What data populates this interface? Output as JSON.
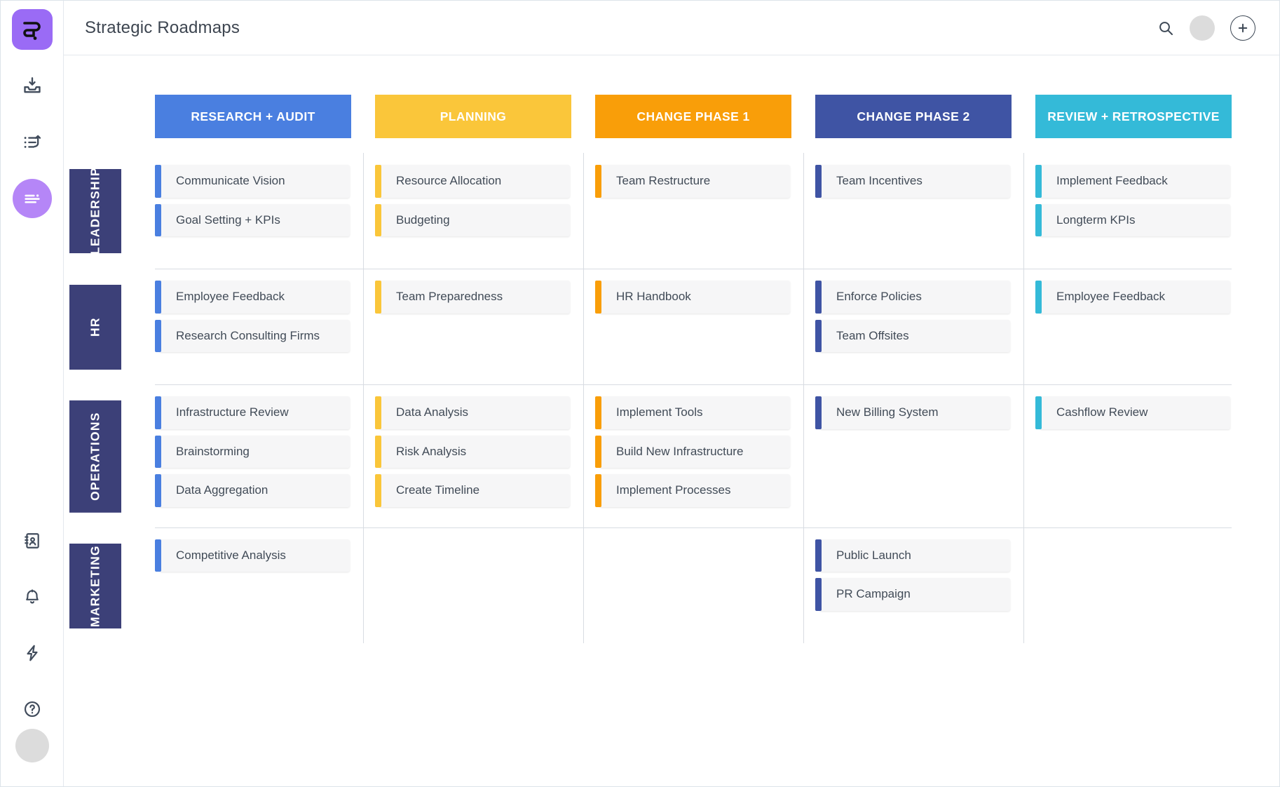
{
  "app": {
    "title": "Strategic Roadmaps",
    "logo_icon": "squiggle-logo-icon",
    "accent": "#9a6bf5"
  },
  "topbar": {
    "search_icon": "search-icon",
    "avatar": "user-avatar",
    "add_label": "+",
    "add_icon": "plus-icon"
  },
  "sidebar": {
    "items": [
      {
        "icon": "inbox-download-icon",
        "active": false
      },
      {
        "icon": "list-arrow-icon",
        "active": false
      },
      {
        "icon": "roadmap-lines-icon",
        "active": true
      }
    ],
    "bottom_items": [
      {
        "icon": "address-book-icon"
      },
      {
        "icon": "bell-icon"
      },
      {
        "icon": "lightning-bolt-icon"
      },
      {
        "icon": "help-circle-icon"
      }
    ],
    "avatar": "user-avatar"
  },
  "board": {
    "columns": [
      {
        "label": "RESEARCH + AUDIT",
        "color": "#4a7fe0"
      },
      {
        "label": "PLANNING",
        "color": "#fac63a"
      },
      {
        "label": "CHANGE PHASE 1",
        "color": "#f99e09"
      },
      {
        "label": "CHANGE PHASE 2",
        "color": "#3f54a4"
      },
      {
        "label": "REVIEW + RETROSPECTIVE",
        "color": "#34bad8"
      }
    ],
    "rows": [
      {
        "label": "LEADERSHIP",
        "cells": [
          [
            "Communicate Vision",
            "Goal Setting + KPIs"
          ],
          [
            "Resource Allocation",
            "Budgeting"
          ],
          [
            "Team Restructure"
          ],
          [
            "Team Incentives"
          ],
          [
            "Implement Feedback",
            "Longterm KPIs"
          ]
        ]
      },
      {
        "label": "HR",
        "cells": [
          [
            "Employee Feedback",
            "Research Consulting Firms"
          ],
          [
            "Team Preparedness"
          ],
          [
            "HR Handbook"
          ],
          [
            "Enforce Policies",
            "Team Offsites"
          ],
          [
            "Employee Feedback"
          ]
        ]
      },
      {
        "label": "OPERATIONS",
        "cells": [
          [
            "Infrastructure Review",
            "Brainstorming",
            "Data Aggregation"
          ],
          [
            "Data Analysis",
            "Risk Analysis",
            "Create Timeline"
          ],
          [
            "Implement Tools",
            "Build New Infrastructure",
            "Implement Processes"
          ],
          [
            "New Billing System"
          ],
          [
            "Cashflow Review"
          ]
        ]
      },
      {
        "label": "MARKETING",
        "cells": [
          [
            "Competitive Analysis"
          ],
          [],
          [],
          [
            "Public Launch",
            "PR Campaign"
          ],
          []
        ]
      }
    ]
  }
}
